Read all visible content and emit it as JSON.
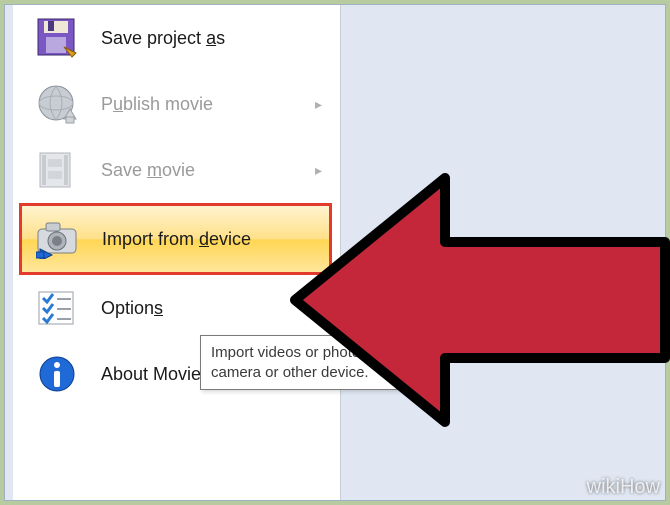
{
  "menu": {
    "save_project_as": {
      "pre": "Save project ",
      "key": "a",
      "post": "s"
    },
    "publish_movie": {
      "pre": "P",
      "key": "u",
      "post": "blish movie"
    },
    "save_movie": {
      "pre": "Save ",
      "key": "m",
      "post": "ovie"
    },
    "import_device": {
      "pre": "Import from ",
      "key": "d",
      "post": "evice"
    },
    "options": {
      "pre": "Option",
      "key": "s",
      "post": ""
    },
    "about": "About Movie Maker"
  },
  "tooltip": "Import videos or photos from a camera or other device.",
  "watermark": "wikiHow"
}
